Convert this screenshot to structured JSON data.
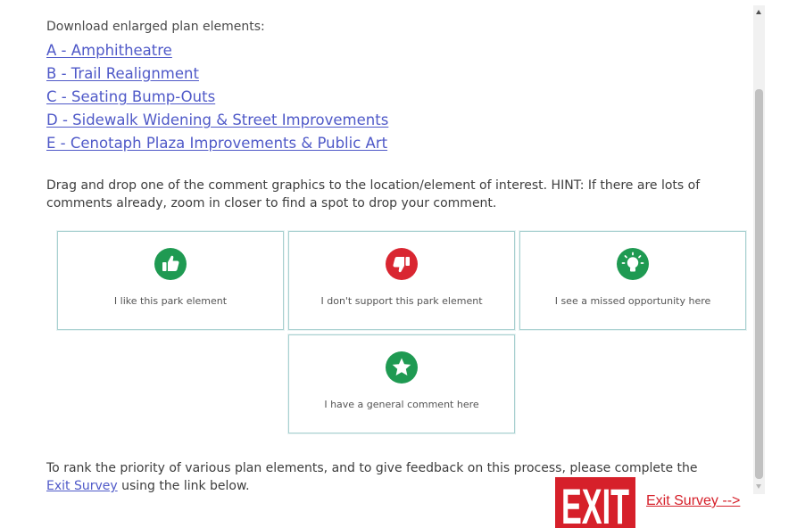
{
  "download": {
    "heading": "Download enlarged plan elements:",
    "links": [
      "A - Amphitheatre",
      "B - Trail Realignment",
      "C - Seating Bump-Outs",
      "D - Sidewalk Widening & Street Improvements",
      "E - Cenotaph Plaza Improvements & Public Art"
    ]
  },
  "instructions": "Drag and drop one of the comment graphics to the location/element of interest. HINT: If there are lots of comments already, zoom in closer to find a spot to drop your comment.",
  "comment_cards": [
    {
      "label": "I like this park element",
      "icon": "thumbs-up-icon",
      "color": "#1f9a52"
    },
    {
      "label": "I don't support this park element",
      "icon": "thumbs-down-icon",
      "color": "#d92631"
    },
    {
      "label": "I see a missed opportunity here",
      "icon": "lightbulb-icon",
      "color": "#1f9a52"
    },
    {
      "label": "I have a general comment here",
      "icon": "star-icon",
      "color": "#1f9a52"
    }
  ],
  "rank": {
    "text_before": "To rank the priority of various plan elements, and to give feedback on this process, please complete the ",
    "link": "Exit Survey",
    "text_after": " using the link below."
  },
  "exit": {
    "sign_text": "EXIT",
    "link_text": "Exit Survey -->",
    "color": "#d6202a"
  },
  "colors": {
    "link": "#4f59c8",
    "card_border": "#a8d0d0",
    "green": "#1f9a52",
    "red": "#d92631"
  }
}
